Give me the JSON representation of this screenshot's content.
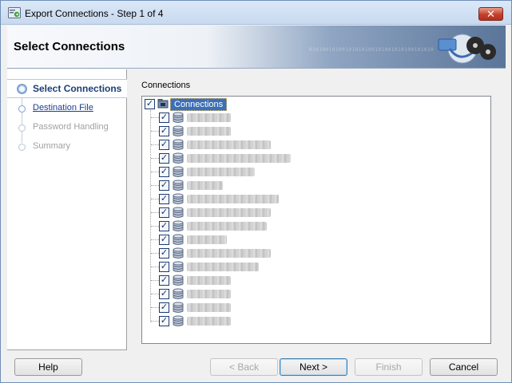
{
  "window": {
    "title": "Export Connections - Step 1 of 4",
    "close_glyph": "✕"
  },
  "header": {
    "title": "Select Connections",
    "binary_decoration": "01010010100101010100101001010100101010"
  },
  "steps": [
    {
      "label": "Select Connections",
      "state": "active"
    },
    {
      "label": "Destination File",
      "state": "link"
    },
    {
      "label": "Password Handling",
      "state": "disabled"
    },
    {
      "label": "Summary",
      "state": "disabled"
    }
  ],
  "content": {
    "label": "Connections",
    "tree": {
      "root": {
        "label": "Connections",
        "checked": true
      },
      "children_count_visible": 16,
      "children_checked": true
    }
  },
  "buttons": {
    "help": "Help",
    "back": "< Back",
    "next": "Next >",
    "finish": "Finish",
    "cancel": "Cancel"
  },
  "colors": {
    "accent": "#3d6fb6",
    "active_step": "#1c3d78",
    "link": "#1a3f8c",
    "close": "#c43f2a"
  },
  "icons": {
    "app": "export-wizard-icon",
    "close": "close-icon",
    "check": "✓",
    "root": "connections-folder-icon",
    "child": "database-icon"
  }
}
